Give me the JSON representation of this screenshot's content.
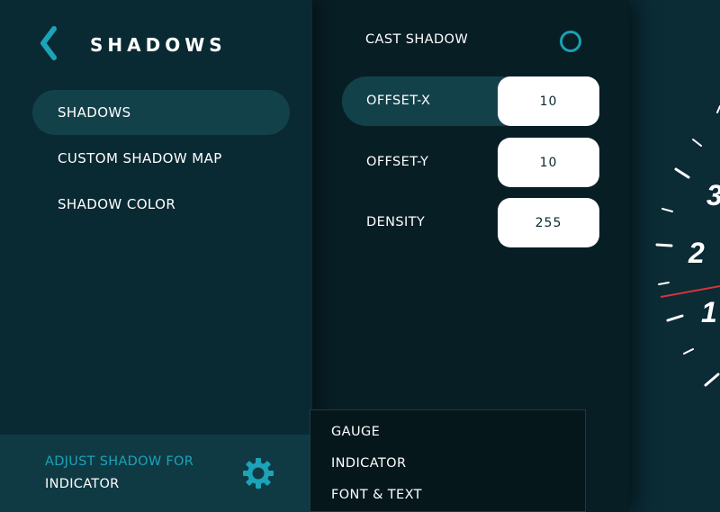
{
  "sidebar": {
    "title": "SHADOWS",
    "items": [
      {
        "label": "SHADOWS",
        "active": true
      },
      {
        "label": "CUSTOM SHADOW MAP",
        "active": false
      },
      {
        "label": "SHADOW COLOR",
        "active": false
      }
    ],
    "adjust_label": "ADJUST SHADOW FOR",
    "adjust_value": "INDICATOR"
  },
  "settings": {
    "cast_shadow_label": "CAST SHADOW",
    "cast_shadow_on": false,
    "fields": [
      {
        "label": "OFFSET-X",
        "value": "10",
        "active": true
      },
      {
        "label": "OFFSET-Y",
        "value": "10",
        "active": false
      },
      {
        "label": "DENSITY",
        "value": "255",
        "active": false
      }
    ]
  },
  "dropdown": {
    "items": [
      "GAUGE",
      "INDICATOR",
      "FONT & TEXT"
    ]
  },
  "gauge": {
    "visible_numbers": [
      "3",
      "2",
      "1"
    ]
  },
  "colors": {
    "accent": "#1ca3b8",
    "panel": "#0a2a33",
    "active_row": "#13414a",
    "needle": "#d8333a"
  },
  "icons": {
    "back": "chevron-left-icon",
    "settings": "gear-icon",
    "toggle": "circle-toggle-icon"
  }
}
